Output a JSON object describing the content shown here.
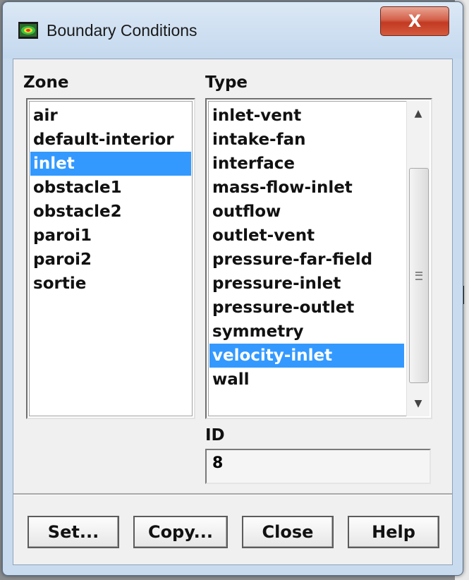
{
  "window": {
    "title": "Boundary Conditions",
    "close_glyph": "X"
  },
  "zone": {
    "label": "Zone",
    "items": [
      "air",
      "default-interior",
      "inlet",
      "obstacle1",
      "obstacle2",
      "paroi1",
      "paroi2",
      "sortie"
    ],
    "selected": "inlet"
  },
  "type": {
    "label": "Type",
    "items": [
      "inlet-vent",
      "intake-fan",
      "interface",
      "mass-flow-inlet",
      "outflow",
      "outlet-vent",
      "pressure-far-field",
      "pressure-inlet",
      "pressure-outlet",
      "symmetry",
      "velocity-inlet",
      "wall"
    ],
    "selected": "velocity-inlet"
  },
  "id": {
    "label": "ID",
    "value": "8"
  },
  "buttons": {
    "set": "Set...",
    "copy": "Copy...",
    "close": "Close",
    "help": "Help"
  },
  "colors": {
    "selection": "#3399ff",
    "dialog_bg": "#f0f0f0",
    "title_close": "#c23a21"
  }
}
